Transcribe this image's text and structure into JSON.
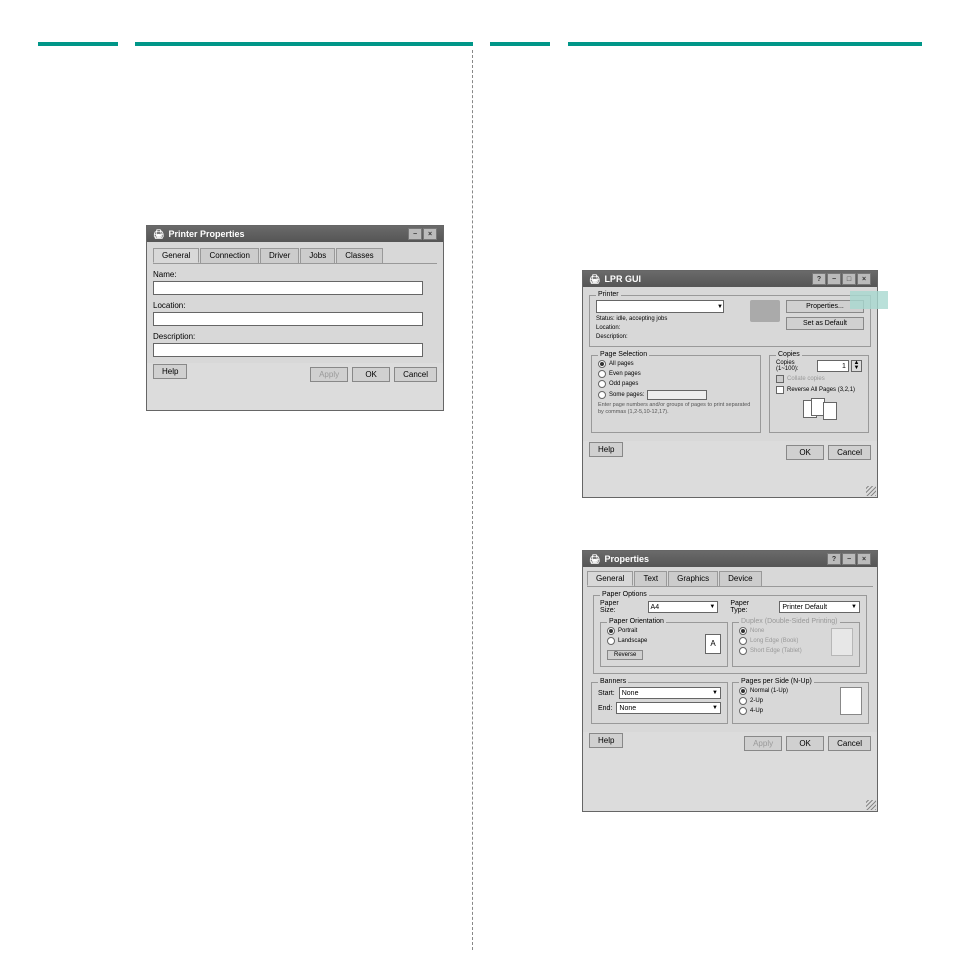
{
  "printer_properties": {
    "title": "Printer Properties",
    "tabs": [
      "General",
      "Connection",
      "Driver",
      "Jobs",
      "Classes"
    ],
    "fields": {
      "name_label": "Name:",
      "location_label": "Location:",
      "description_label": "Description:"
    },
    "buttons": {
      "help": "Help",
      "apply": "Apply",
      "ok": "OK",
      "cancel": "Cancel"
    }
  },
  "lpr": {
    "title": "LPR GUI",
    "printer_legend": "Printer",
    "status": "Status: idle, accepting jobs",
    "location_label": "Location:",
    "description_label": "Description:",
    "properties_btn": "Properties...",
    "default_btn": "Set as Default",
    "page_sel_legend": "Page Selection",
    "all_pages": "All pages",
    "even_pages": "Even pages",
    "odd_pages": "Odd pages",
    "some_pages": "Some pages:",
    "help_text": "Enter page numbers and/or groups of pages to print separated by commas (1,2-5,10-12,17).",
    "copies_legend": "Copies",
    "copies_label": "Copies (1~100):",
    "copies_value": "1",
    "collate": "Collate copies",
    "reverse": "Reverse All Pages (3,2,1)",
    "buttons": {
      "help": "Help",
      "ok": "OK",
      "cancel": "Cancel"
    }
  },
  "props": {
    "title": "Properties",
    "tabs": [
      "General",
      "Text",
      "Graphics",
      "Device"
    ],
    "paper_legend": "Paper Options",
    "paper_size_label": "Paper Size:",
    "paper_size": "A4",
    "paper_type_label": "Paper Type:",
    "paper_type": "Printer Default",
    "orient_legend": "Paper Orientation",
    "portrait": "Portrait",
    "landscape": "Landscape",
    "reverse": "Reverse",
    "orient_glyph": "A",
    "duplex_legend": "Duplex (Double-Sided Printing)",
    "duplex_none": "None",
    "duplex_long": "Long Edge (Book)",
    "duplex_short": "Short Edge (Tablet)",
    "banners_legend": "Banners",
    "start_label": "Start:",
    "end_label": "End:",
    "none_val": "None",
    "nup_legend": "Pages per Side (N-Up)",
    "nup_1": "Normal (1-Up)",
    "nup_2": "2-Up",
    "nup_4": "4-Up",
    "buttons": {
      "help": "Help",
      "apply": "Apply",
      "ok": "OK",
      "cancel": "Cancel"
    }
  }
}
